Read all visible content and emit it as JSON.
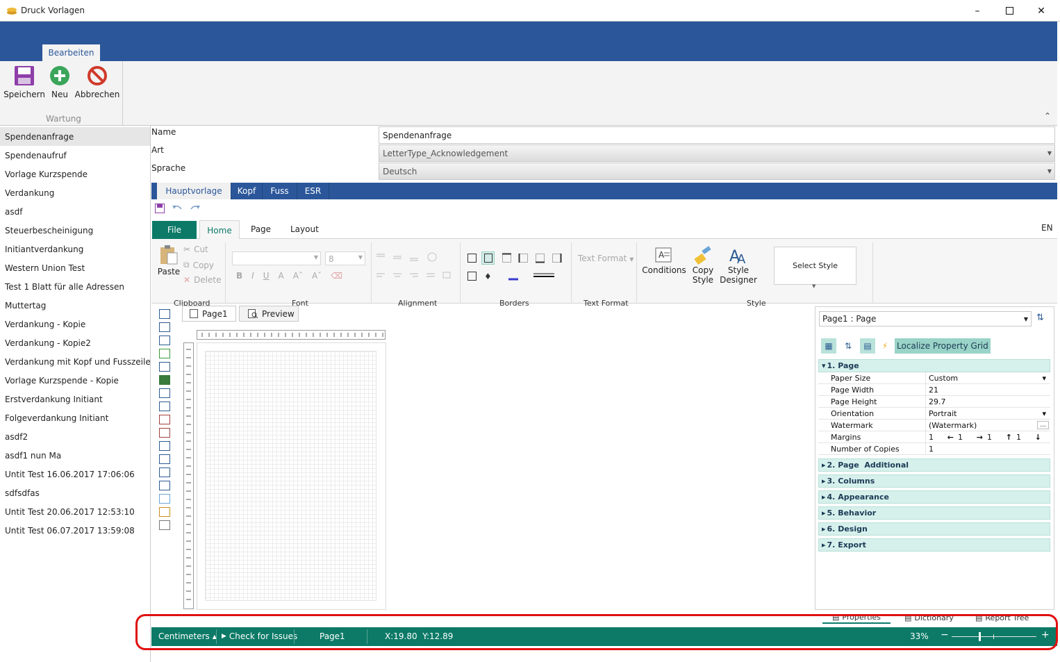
{
  "window": {
    "title": "Druck Vorlagen"
  },
  "ribbon": {
    "tab": "Bearbeiten",
    "buttons": {
      "save": "Speichern",
      "new": "Neu",
      "cancel": "Abbrechen"
    },
    "group": "Wartung"
  },
  "templates": [
    "Spendenanfrage",
    "Spendenaufruf",
    "Vorlage Kurzspende",
    "Verdankung",
    "asdf",
    "Steuerbescheinigung",
    "Initiantverdankung",
    "Western Union Test",
    "Test 1 Blatt für alle Adressen",
    "Muttertag",
    "Verdankung - Kopie",
    "Verdankung - Kopie2",
    "Verdankung mit Kopf und Fusszeile DE",
    "Vorlage Kurzspende - Kopie",
    "Erstverdankung Initiant",
    "Folgeverdankung Initiant",
    "asdf2",
    "asdf1 nun Ma",
    "Untit Test 16.06.2017 17:06:06",
    "sdfsdfas",
    "Untit Test 20.06.2017 12:53:10",
    "Untit Test 06.07.2017 13:59:08"
  ],
  "form": {
    "name_label": "Name",
    "name_value": "Spendenanfrage",
    "art_label": "Art",
    "art_value": "LetterType_Acknowledgement",
    "sprache_label": "Sprache",
    "sprache_value": "Deutsch"
  },
  "designer_tabs": [
    "Hauptvorlage",
    "Kopf",
    "Fuss",
    "ESR"
  ],
  "stimulsoft": {
    "tabs": {
      "file": "File",
      "home": "Home",
      "page": "Page",
      "layout": "Layout",
      "lang": "EN"
    },
    "clipboard": {
      "paste": "Paste",
      "cut": "Cut",
      "copy": "Copy",
      "delete": "Delete",
      "group": "Clipboard"
    },
    "font": {
      "size": "8",
      "group": "Font"
    },
    "alignment": {
      "group": "Alignment"
    },
    "borders": {
      "group": "Borders"
    },
    "textformat": {
      "button": "Text Format",
      "group": "Text Format"
    },
    "style": {
      "conditions": "Conditions",
      "copy_style_1": "Copy",
      "copy_style_2": "Style",
      "style_designer_1": "Style",
      "style_designer_2": "Designer",
      "select_style": "Select Style",
      "group": "Style"
    },
    "page_tab": "Page1",
    "preview_tab": "Preview"
  },
  "properties": {
    "selector": "Page1 : Page",
    "localize": "Localize Property Grid",
    "categories": [
      "1. Page",
      "2. Page  Additional",
      "3. Columns",
      "4. Appearance",
      "5. Behavior",
      "6. Design",
      "7. Export"
    ],
    "rows": [
      {
        "name": "Paper Size",
        "value": "Custom"
      },
      {
        "name": "Page Width",
        "value": "21"
      },
      {
        "name": "Page Height",
        "value": "29.7"
      },
      {
        "name": "Orientation",
        "value": "Portrait"
      },
      {
        "name": "Watermark",
        "value": "(Watermark)"
      },
      {
        "name": "Margins",
        "value": "1"
      },
      {
        "name": "Number of Copies",
        "value": "1"
      }
    ],
    "margins": [
      "1",
      "1",
      "1",
      "1"
    ],
    "bottom_tabs": [
      "Properties",
      "Dictionary",
      "Report Tree"
    ]
  },
  "status": {
    "units": "Centimeters",
    "check": "Check for Issues",
    "page": "Page1",
    "coords": "X:19.80  Y:12.89",
    "zoom": "33%",
    "zoom_level": 0.33
  },
  "colors": {
    "ribbon_blue": "#2b579a",
    "status_green": "#0c7a67",
    "file_green": "#0c7a67",
    "highlight_red": "#e01010"
  }
}
